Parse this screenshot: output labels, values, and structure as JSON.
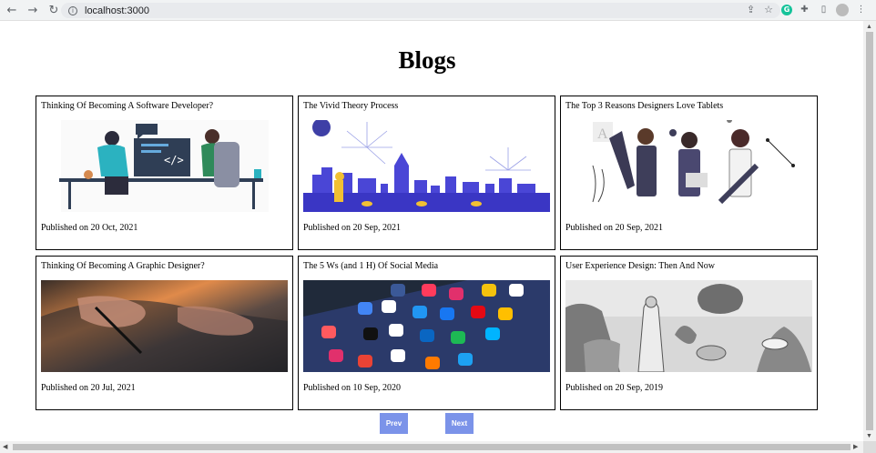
{
  "browser": {
    "url": "localhost:3000",
    "nav_back": "←",
    "nav_forward": "→",
    "nav_reload": "↻",
    "info": "i"
  },
  "page": {
    "title": "Blogs"
  },
  "blogs": [
    {
      "title": "Thinking Of Becoming A Software Developer?",
      "published": "Published on 20 Oct, 2021",
      "image": "developers-illustration"
    },
    {
      "title": "The Vivid Theory Process",
      "published": "Published on 20 Sep, 2021",
      "image": "city-fireworks-illustration"
    },
    {
      "title": "The Top 3 Reasons Designers Love Tablets",
      "published": "Published on 20 Sep, 2021",
      "image": "designers-illustration"
    },
    {
      "title": "Thinking Of Becoming A Graphic Designer?",
      "published": "Published on 20 Jul, 2021",
      "image": "stylus-tablet-photo"
    },
    {
      "title": "The 5 Ws (and 1 H) Of Social Media",
      "published": "Published on 10 Sep, 2020",
      "image": "smartphone-apps-photo"
    },
    {
      "title": "User Experience Design: Then And Now",
      "published": "Published on 20 Sep, 2019",
      "image": "vintage-engraving"
    }
  ],
  "pagination": {
    "prev_label": "Prev",
    "next_label": "Next"
  },
  "colors": {
    "button": "#7b93e9",
    "border": "#000000"
  }
}
